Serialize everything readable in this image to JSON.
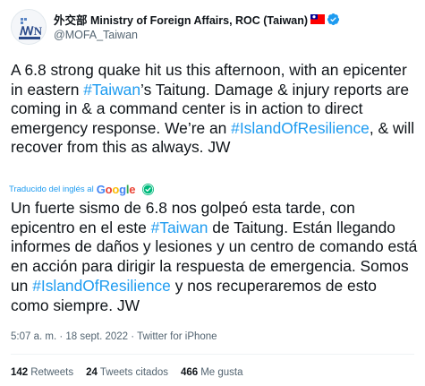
{
  "account": {
    "name": "外交部 Ministry of Foreign Affairs, ROC (Taiwan)",
    "handle": "@MOFA_Taiwan",
    "avatar_icon": "mofa-logo-icon",
    "flag_icon": "taiwan-flag-icon",
    "verified_icon": "verified-badge-icon"
  },
  "tweet": {
    "seg1": "A 6.8 strong quake hit us this afternoon, with an epicenter in eastern ",
    "tag1": "#Taiwan",
    "seg2": "’s Taitung. Damage & injury reports are coming in & a command center is in action to direct emergency response. We’re an ",
    "tag2": "#IslandOfResilience",
    "seg3": ", & will recover from this as always. JW"
  },
  "translation_label": {
    "text": "Traducido del inglés al",
    "brand": "Google"
  },
  "translation": {
    "seg1": "Un fuerte sismo de 6.8 nos golpeó esta tarde, con epicentro en el este ",
    "tag1": "#Taiwan",
    "seg2": " de Taitung. Están llegando informes de daños y lesiones y un centro de comando está en acción para dirigir la respuesta de emergencia. Somos un ",
    "tag2": "#IslandOfResilience",
    "seg3": " y nos recuperaremos de esto como siempre. JW"
  },
  "meta": {
    "time": "5:07 a. m.",
    "sep1": " · ",
    "date": "18 sept. 2022",
    "sep2": " · ",
    "source": "Twitter for iPhone"
  },
  "stats": {
    "retweets_count": "142",
    "retweets_label": "Retweets",
    "quotes_count": "24",
    "quotes_label": "Tweets citados",
    "likes_count": "466",
    "likes_label": "Me gusta"
  },
  "colors": {
    "link": "#1d9bf0",
    "text": "#0f1419",
    "secondary": "#536471"
  }
}
